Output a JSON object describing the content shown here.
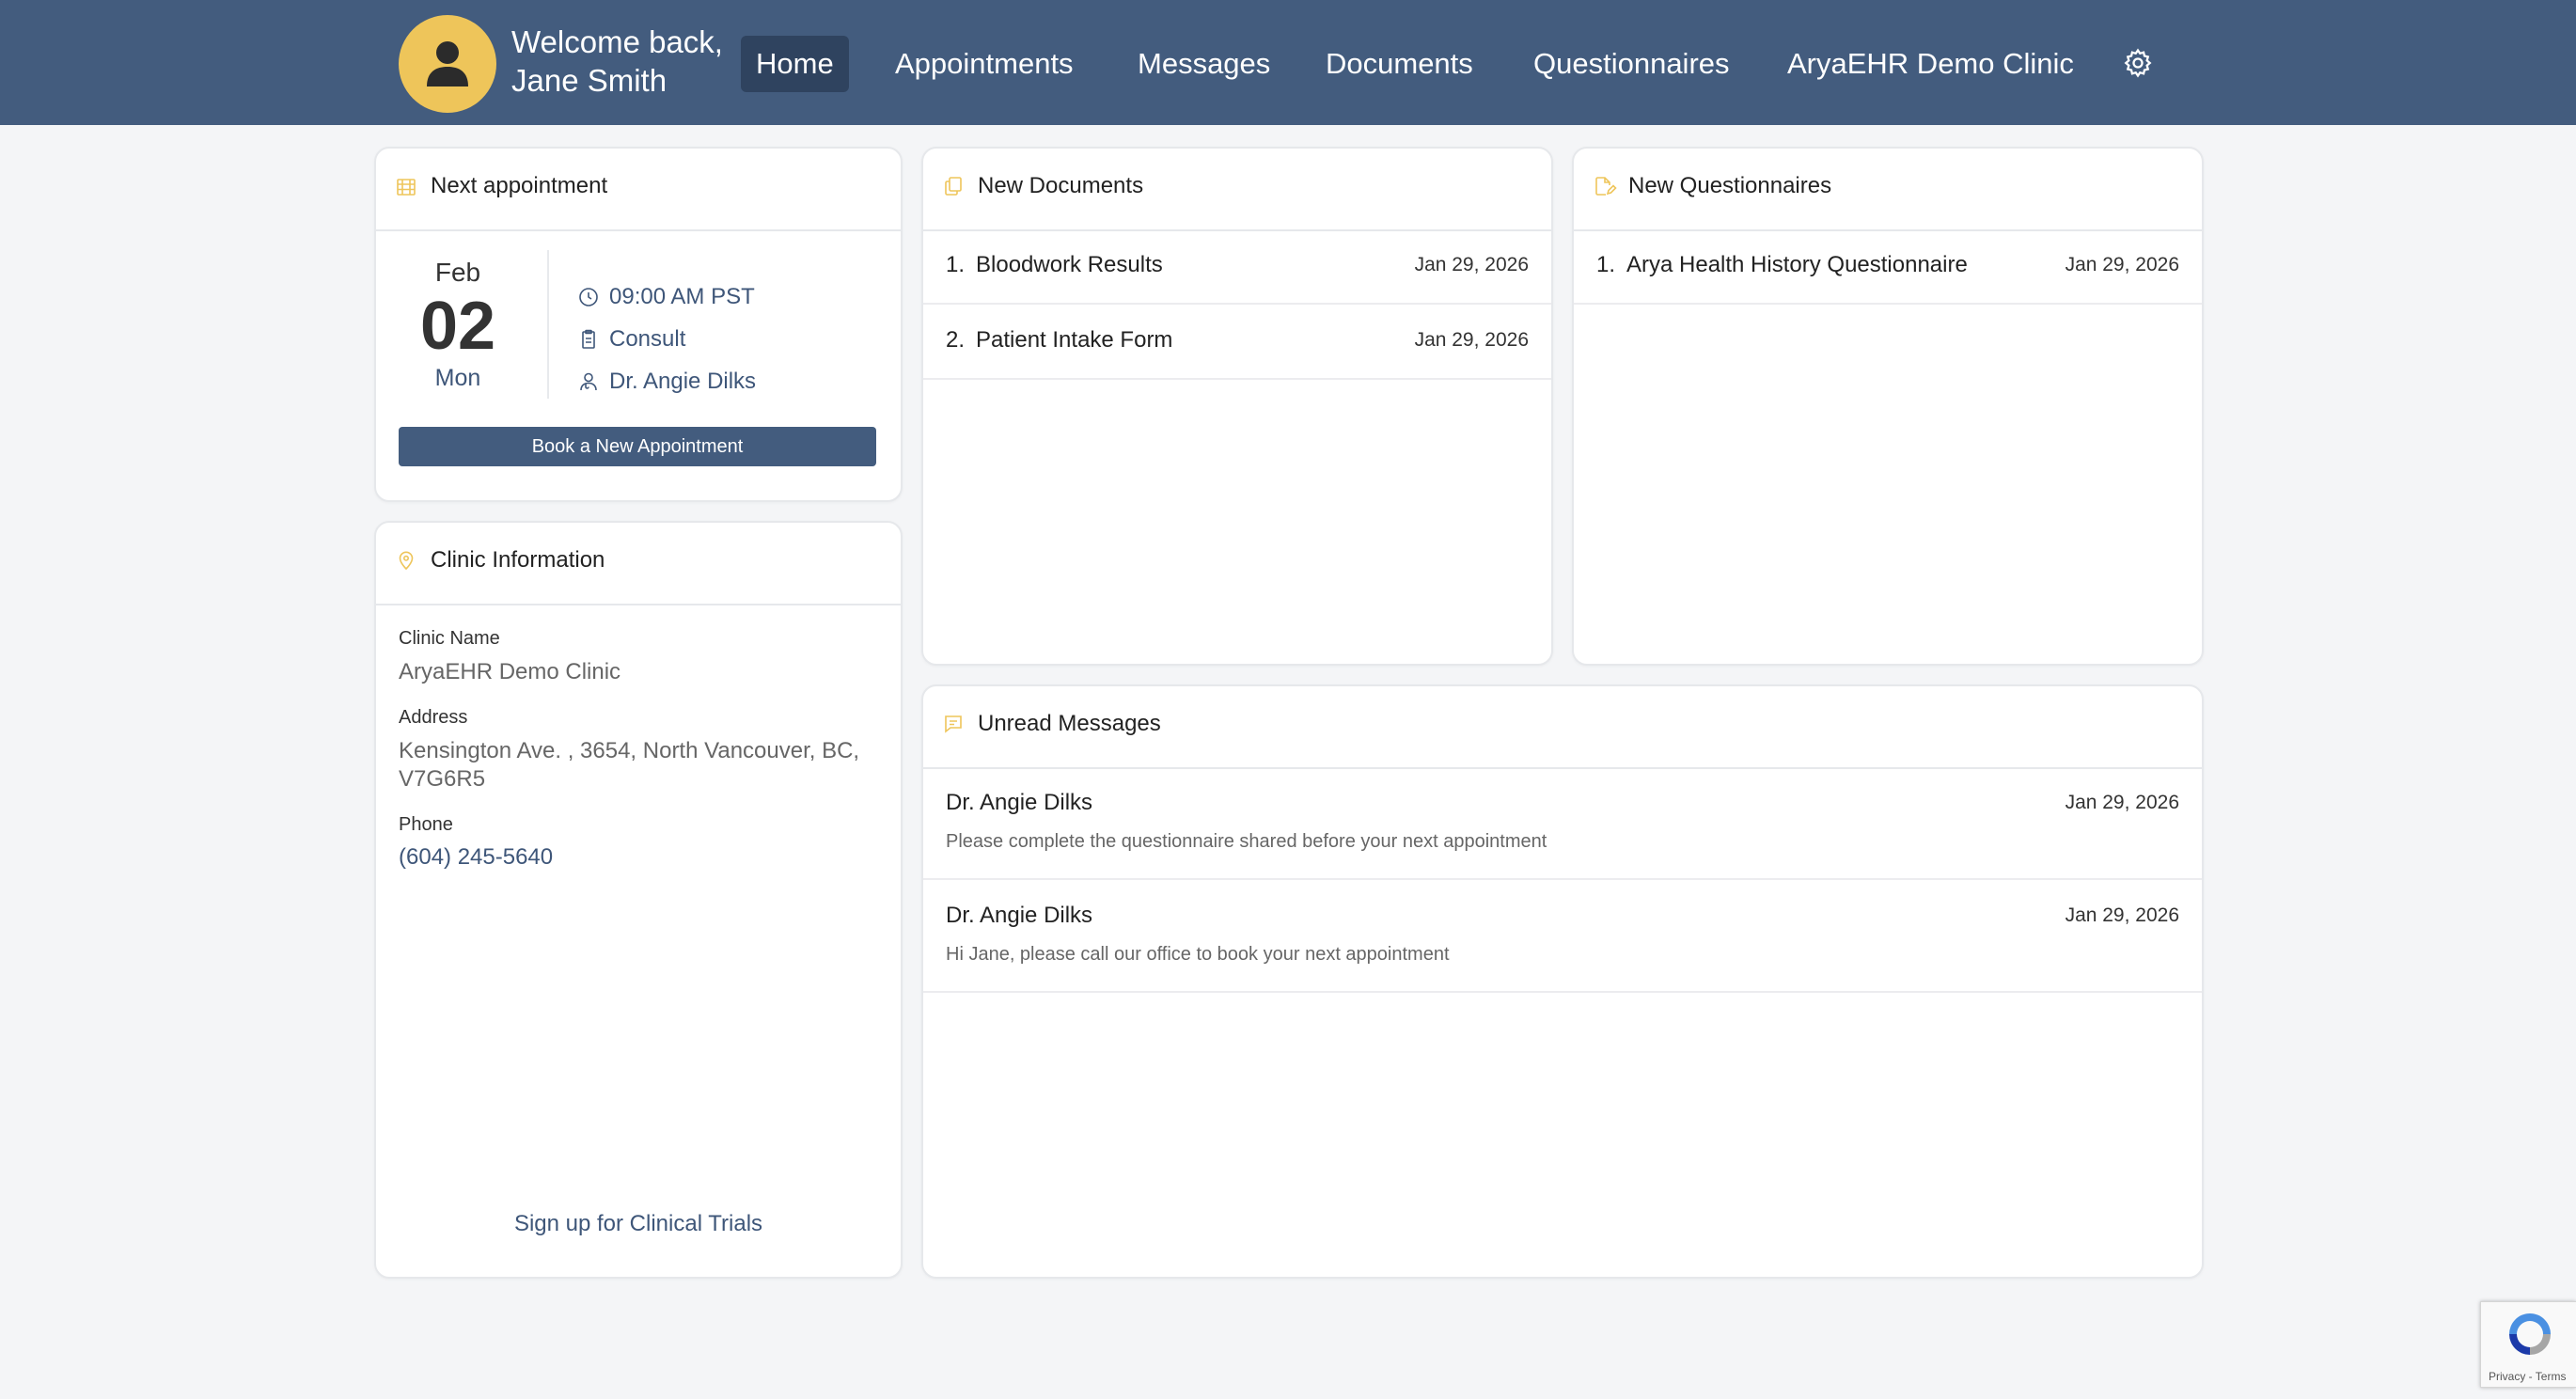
{
  "header": {
    "welcome_line1": "Welcome back,",
    "welcome_line2": "Jane Smith",
    "nav": {
      "home": "Home",
      "appointments": "Appointments",
      "messages": "Messages",
      "documents": "Documents",
      "questionnaires": "Questionnaires",
      "clinic": "AryaEHR Demo Clinic"
    },
    "accent": "#eec55a",
    "bar_color": "#435c7e"
  },
  "next_appointment": {
    "title": "Next appointment",
    "month": "Feb",
    "day": "02",
    "weekday": "Mon",
    "time": "09:00 AM PST",
    "type": "Consult",
    "provider": "Dr. Angie Dilks",
    "book_label": "Book a New Appointment"
  },
  "clinic_info": {
    "title": "Clinic Information",
    "name_label": "Clinic Name",
    "name": "AryaEHR Demo Clinic",
    "address_label": "Address",
    "address": "Kensington Ave. , 3654, North Vancouver, BC, V7G6R5",
    "phone_label": "Phone",
    "phone": "(604) 245-5640",
    "trials_link": "Sign up for Clinical Trials"
  },
  "new_documents": {
    "title": "New Documents",
    "items": [
      {
        "num": "1.",
        "name": "Bloodwork Results",
        "date": "Jan 29, 2026"
      },
      {
        "num": "2.",
        "name": "Patient Intake Form",
        "date": "Jan 29, 2026"
      }
    ]
  },
  "new_questionnaires": {
    "title": "New Questionnaires",
    "items": [
      {
        "num": "1.",
        "name": "Arya Health History Questionnaire",
        "date": "Jan 29, 2026"
      }
    ]
  },
  "unread_messages": {
    "title": "Unread Messages",
    "items": [
      {
        "from": "Dr. Angie Dilks",
        "date": "Jan 29, 2026",
        "preview": "Please complete the questionnaire shared before your next appointment"
      },
      {
        "from": "Dr. Angie Dilks",
        "date": "Jan 29, 2026",
        "preview": "Hi Jane, please call our office to book your next appointment"
      }
    ]
  },
  "recaptcha": {
    "links": "Privacy - Terms"
  },
  "icons": {
    "avatar": "user-icon",
    "settings": "gear-icon",
    "appointment": "calendar-icon",
    "clinic": "map-pin-icon",
    "documents": "copy-icon",
    "questionnaires": "file-edit-icon",
    "messages": "chat-icon"
  }
}
